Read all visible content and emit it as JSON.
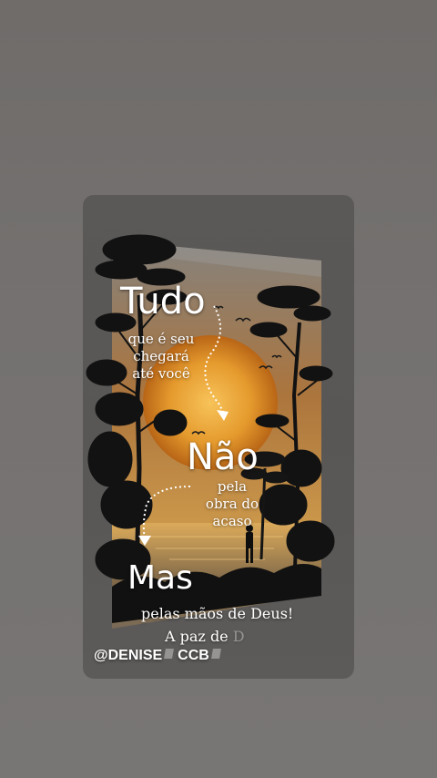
{
  "story": {
    "line1_big": "Tudo",
    "line1_small": [
      "que é seu",
      "chegará",
      "até você"
    ],
    "line2_big": "Não",
    "line2_small": [
      "pela",
      "obra do",
      "acaso"
    ],
    "line3_big": "Mas",
    "line3_small": "pelas mãos de Deus!",
    "footer_note_visible": "A paz de ",
    "footer_note_faded": "D",
    "author_part1": "@DENISE",
    "author_part2": "CCB"
  },
  "colors": {
    "page_bg": "#747170",
    "card_bg": "#5a5856",
    "sun": "#e8a23b",
    "silhouette": "#111111",
    "text": "#ffffff"
  },
  "icons": [
    "arrow-down-icon",
    "flag-icon",
    "bird-icon"
  ]
}
